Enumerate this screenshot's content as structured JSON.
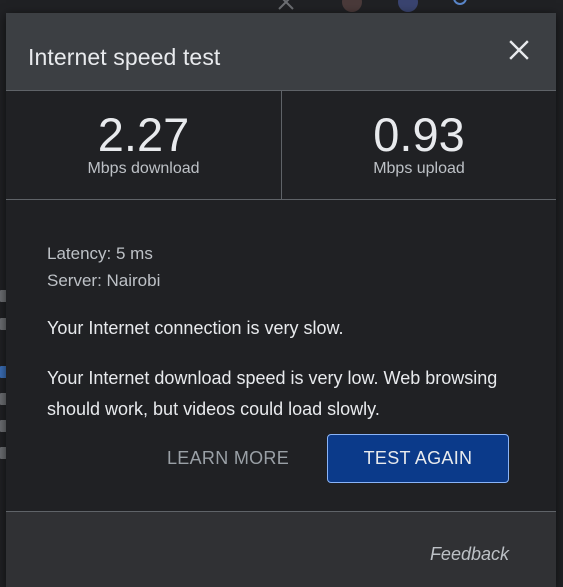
{
  "dialog": {
    "title": "Internet speed test",
    "close_icon": "close-icon"
  },
  "results": {
    "download": {
      "value": "2.27",
      "label": "Mbps download"
    },
    "upload": {
      "value": "0.93",
      "label": "Mbps upload"
    }
  },
  "details": {
    "latency": "Latency: 5 ms",
    "server": "Server: Nairobi"
  },
  "messages": {
    "summary": "Your Internet connection is very slow.",
    "detail": "Your Internet download speed is very low. Web browsing should work, but videos could load slowly."
  },
  "actions": {
    "learn_more": "LEARN MORE",
    "test_again": "TEST AGAIN"
  },
  "footer": {
    "feedback": "Feedback"
  },
  "colors": {
    "primary_button": "#0b3a8a",
    "primary_button_border": "#8ab4f8"
  }
}
